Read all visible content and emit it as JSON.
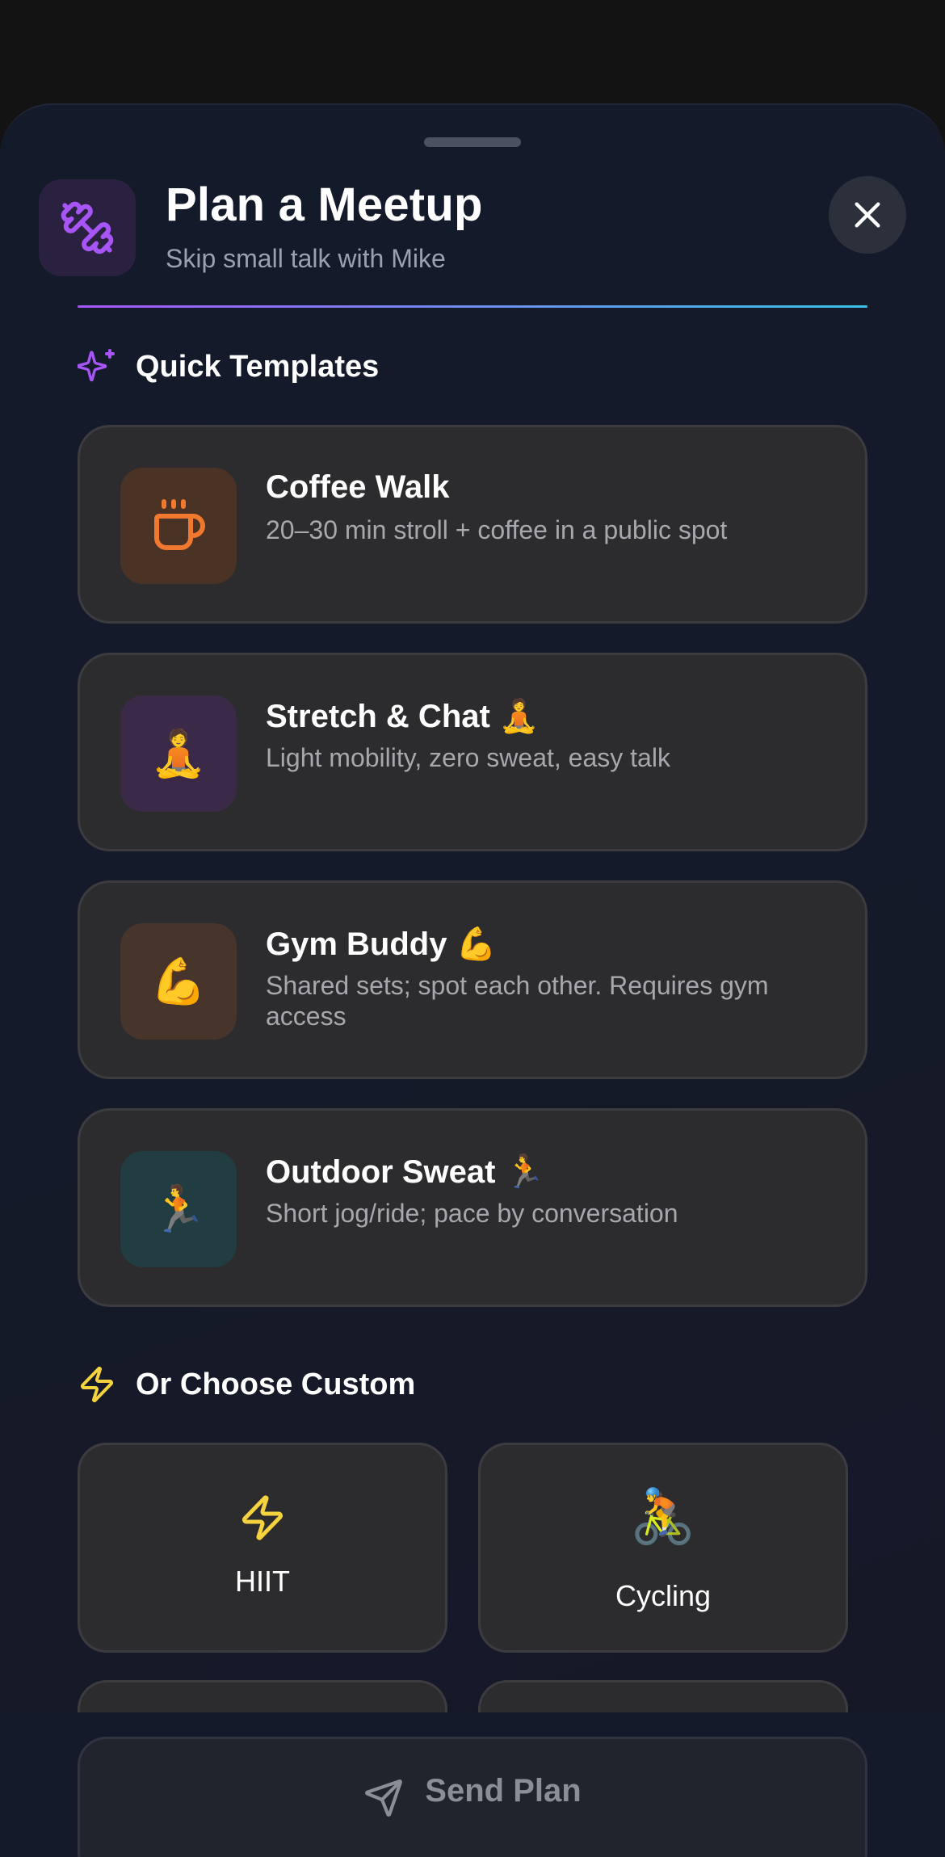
{
  "sheet": {
    "title": "Plan a Meetup",
    "subtitle": "Skip small talk with Mike",
    "header_icon": "dumbbell-icon",
    "close_icon": "close-icon"
  },
  "quick_templates": {
    "heading": "Quick Templates",
    "heading_icon": "sparkles-icon",
    "items": [
      {
        "title": "Coffee Walk",
        "description": "20–30 min stroll + coffee in a public spot",
        "icon": "coffee-cup-icon",
        "icon_bg": "#4a3225"
      },
      {
        "title": "Stretch & Chat 🧘",
        "description": "Light mobility, zero sweat, easy talk",
        "icon": "🧘",
        "icon_bg": "#3b2a47"
      },
      {
        "title": "Gym Buddy 💪",
        "description": "Shared sets; spot each other. Requires gym access",
        "icon": "💪",
        "icon_bg": "#47342a"
      },
      {
        "title": "Outdoor Sweat 🏃",
        "description": "Short jog/ride; pace by conversation",
        "icon": "🏃",
        "icon_bg": "#213d42"
      }
    ]
  },
  "custom": {
    "heading": "Or Choose Custom",
    "heading_icon": "lightning-icon",
    "options": [
      {
        "label": "HIIT",
        "icon": "lightning-icon"
      },
      {
        "label": "Cycling",
        "icon": "🚴"
      }
    ]
  },
  "send_button": {
    "label": "Send Plan",
    "icon": "paper-plane-icon"
  },
  "colors": {
    "accent_purple": "#a855f7",
    "accent_cyan": "#38c3e4",
    "accent_yellow": "#f5d33f",
    "coffee_orange": "#f0782f"
  }
}
